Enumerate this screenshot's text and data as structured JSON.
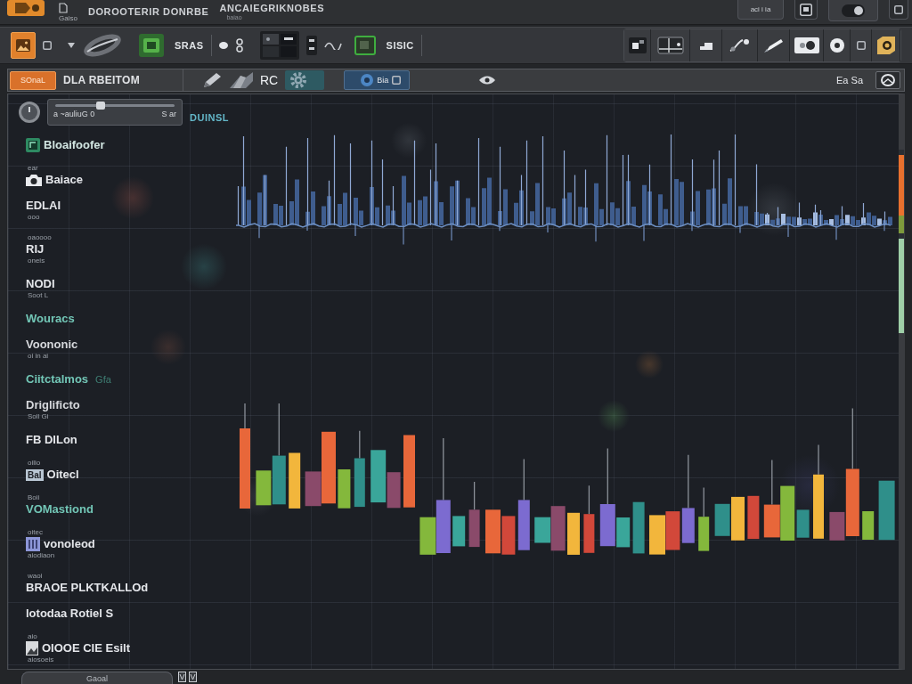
{
  "title_bar": {
    "caption": "Gaiso",
    "title": "DOROOTERIR DONRBE",
    "subtitle": "ANCAIEGRIKNOBES",
    "note": "baiao",
    "button": "aci i ia"
  },
  "toolbar": {
    "labels": [
      "SRAS",
      "SISIC"
    ]
  },
  "panel_bar": {
    "mode": "SOnaL",
    "title": "DLA RBEITOM",
    "label": "RC",
    "selector": "Bia",
    "right_label": "Ea Sa"
  },
  "controls": {
    "slider": {
      "level": 0.38,
      "readings": [
        "a ~auliuG 0",
        "S ar"
      ]
    },
    "value": "DUINSL"
  },
  "sidebar": {
    "items": [
      {
        "kind": "tile",
        "label": "Bloaifoofer",
        "color": "#d2e6e2"
      },
      {
        "kind": "camera",
        "caption": "ear",
        "label": "Baiace",
        "color": "#e4e6ea"
      },
      {
        "kind": "plain",
        "label": "EDLAI",
        "note": "ooo",
        "color": "#e4e6ea"
      },
      {
        "kind": "plain",
        "caption": "oaoooo",
        "label": "RIJ",
        "note": "oneis",
        "color": "#e4e6ea"
      },
      {
        "kind": "plain",
        "label": "NODI",
        "note": "Soot L",
        "color": "#e4e6ea"
      },
      {
        "kind": "plain",
        "label": "Wouracs",
        "color": "#72c6b6"
      },
      {
        "kind": "plain",
        "label": "Voononic",
        "note": "oi in ai",
        "color": "#d6d8dc"
      },
      {
        "kind": "plain",
        "label": "Ciitctalmos",
        "aside": "Gfa",
        "color": "#72c6b6"
      },
      {
        "kind": "plain",
        "label": "Driglificto",
        "note": "Soll Gi",
        "color": "#d6d8dc"
      },
      {
        "kind": "plain",
        "label": "FB DILon",
        "color": "#e4e6ea"
      },
      {
        "kind": "badge",
        "caption": "oilio",
        "badge": "Bal",
        "label": "Oitecl",
        "color": "#e4e6ea"
      },
      {
        "kind": "plain",
        "caption": "Boii",
        "label": "VOMastiond",
        "color": "#72c6b6"
      },
      {
        "kind": "square",
        "caption": "oitec",
        "label": "vonoleod",
        "note": "aiodiaon",
        "color": "#e4e6ea"
      },
      {
        "kind": "plain",
        "caption": "waoi",
        "label": "BRAOE PLKTKALLOd",
        "color": "#e4e6ea"
      },
      {
        "kind": "plain",
        "label": "lotodaa Rotiel S",
        "color": "#e4e6ea"
      },
      {
        "kind": "picture",
        "caption": "aio",
        "label": "OIOOE CIE Esilt",
        "note": "aiosoeis",
        "color": "#e4e6ea"
      }
    ]
  },
  "meter": {
    "level": 0.97
  },
  "footer": {
    "tab": "Gaoal"
  }
}
